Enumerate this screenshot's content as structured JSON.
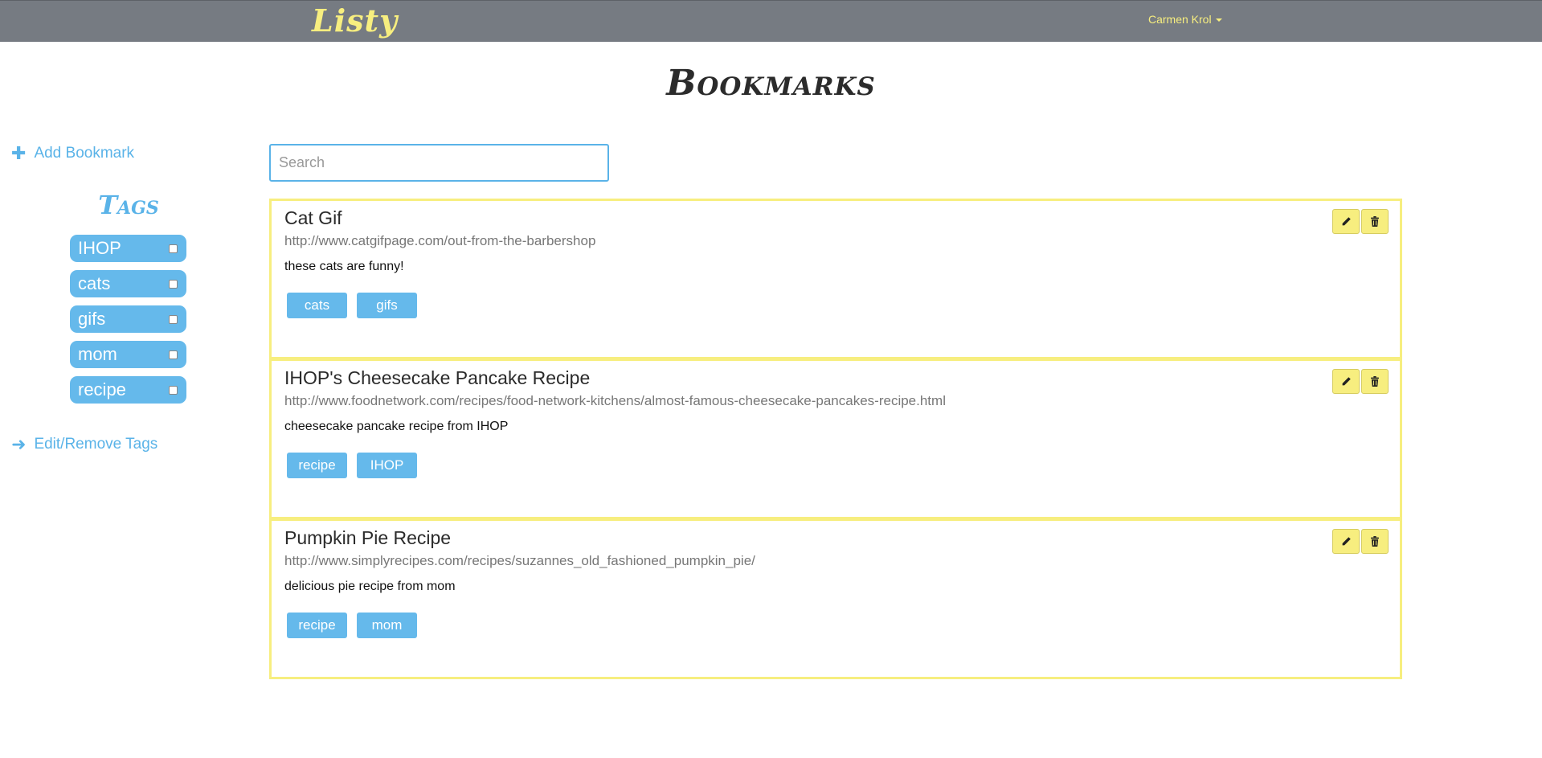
{
  "navbar": {
    "brand": "Listy",
    "user_name": "Carmen Krol",
    "brand_color": "#f7ee7f",
    "background_color": "#767b82"
  },
  "page": {
    "title": "Bookmarks"
  },
  "sidebar": {
    "add_bookmark_label": "Add Bookmark",
    "add_bookmark_icon": "plus-icon",
    "tags_heading": "Tags",
    "tags": [
      "IHOP",
      "cats",
      "gifs",
      "mom",
      "recipe"
    ],
    "edit_tags_label": "Edit/Remove Tags",
    "edit_tags_icon": "arrow-right-icon",
    "accent_color": "#5ab3e8"
  },
  "search": {
    "placeholder": "Search",
    "value": ""
  },
  "bookmarks": [
    {
      "title": "Cat Gif",
      "url": "http://www.catgifpage.com/out-from-the-barbershop",
      "description": "these cats are funny!",
      "tags": [
        "cats",
        "gifs"
      ]
    },
    {
      "title": "IHOP's Cheesecake Pancake Recipe",
      "url": "http://www.foodnetwork.com/recipes/food-network-kitchens/almost-famous-cheesecake-pancakes-recipe.html",
      "description": "cheesecake pancake recipe from IHOP",
      "tags": [
        "recipe",
        "IHOP"
      ]
    },
    {
      "title": "Pumpkin Pie Recipe",
      "url": "http://www.simplyrecipes.com/recipes/suzannes_old_fashioned_pumpkin_pie/",
      "description": "delicious pie recipe from mom",
      "tags": [
        "recipe",
        "mom"
      ]
    }
  ],
  "bookmark_actions": {
    "edit_icon": "pencil-icon",
    "delete_icon": "trash-icon",
    "border_color": "#f7ee7f"
  }
}
